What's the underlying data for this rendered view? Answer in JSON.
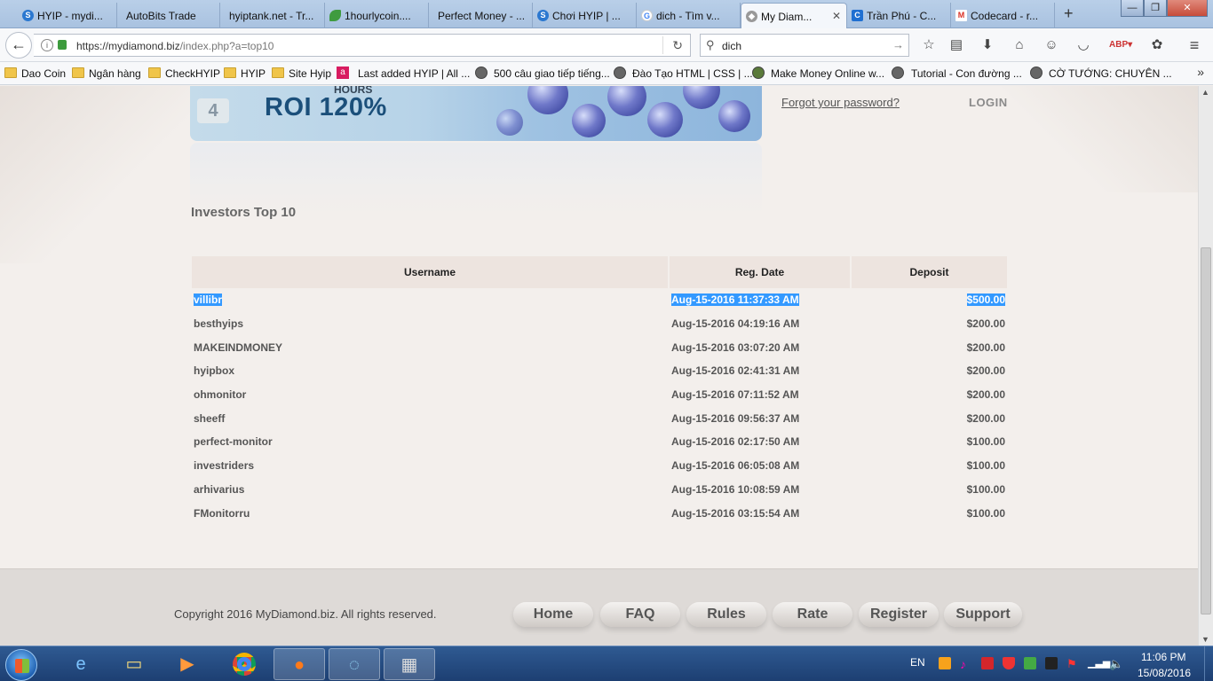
{
  "browser": {
    "tabs": [
      {
        "label": "HYIP - mydi...",
        "icon": "hyip-icon",
        "color": "#2b78d0"
      },
      {
        "label": "AutoBits Trade",
        "icon": "none",
        "color": "#ffffff"
      },
      {
        "label": "hyiptank.net - Tr...",
        "icon": "none",
        "color": "#ffffff"
      },
      {
        "label": "1hourlycoin....",
        "icon": "leaf-icon",
        "color": "#3f9b3f"
      },
      {
        "label": "Perfect Money - ...",
        "icon": "none",
        "color": "#ffffff"
      },
      {
        "label": "Chơi HYIP | ...",
        "icon": "hyip-icon",
        "color": "#2b78d0"
      },
      {
        "label": "dich - Tìm v...",
        "icon": "google-icon",
        "color": "#4285f4"
      },
      {
        "label": "My Diam...",
        "icon": "diamond-icon",
        "color": "#888888"
      },
      {
        "label": "Trần Phú - C...",
        "icon": "c-icon",
        "color": "#1f6fd1"
      },
      {
        "label": "Codecard - r...",
        "icon": "gmail-icon",
        "color": "#d93025"
      }
    ],
    "url_host": "https://mydiamond.biz",
    "url_path": "/index.php?a=top10",
    "search_value": "dich",
    "bookmarks": [
      {
        "label": "Dao Coin",
        "type": "folder"
      },
      {
        "label": "Ngân hàng",
        "type": "folder"
      },
      {
        "label": "CheckHYIP",
        "type": "folder"
      },
      {
        "label": "HYIP",
        "type": "folder"
      },
      {
        "label": "Site Hyip",
        "type": "folder"
      },
      {
        "label": "Last added HYIP | All ...",
        "type": "a-icon"
      },
      {
        "label": "500 câu giao tiếp tiếng...",
        "type": "globe"
      },
      {
        "label": "Đào Tạo HTML | CSS | ...",
        "type": "globe"
      },
      {
        "label": "Make Money Online w...",
        "type": "globe"
      },
      {
        "label": "Tutorial - Con đường ...",
        "type": "globe"
      },
      {
        "label": "CỜ TƯỚNG: CHUYÊN ...",
        "type": "globe"
      }
    ]
  },
  "page": {
    "banner": {
      "step_number": "4",
      "hours_label": "HOURS",
      "roi_label": "ROI 120%"
    },
    "forgot_password": "Forgot your password?",
    "login_label": "LOGIN",
    "section_title": "Investors Top 10",
    "table": {
      "headers": [
        "Username",
        "Reg. Date",
        "Deposit"
      ],
      "rows": [
        {
          "username": "villibr",
          "reg_date": "Aug-15-2016 11:37:33 AM",
          "deposit": "$500.00"
        },
        {
          "username": "besthyips",
          "reg_date": "Aug-15-2016 04:19:16 AM",
          "deposit": "$200.00"
        },
        {
          "username": "MAKEINDMONEY",
          "reg_date": "Aug-15-2016 03:07:20 AM",
          "deposit": "$200.00"
        },
        {
          "username": "hyipbox",
          "reg_date": "Aug-15-2016 02:41:31 AM",
          "deposit": "$200.00"
        },
        {
          "username": "ohmonitor",
          "reg_date": "Aug-15-2016 07:11:52 AM",
          "deposit": "$200.00"
        },
        {
          "username": "sheeff",
          "reg_date": "Aug-15-2016 09:56:37 AM",
          "deposit": "$200.00"
        },
        {
          "username": "perfect-monitor",
          "reg_date": "Aug-15-2016 02:17:50 AM",
          "deposit": "$100.00"
        },
        {
          "username": "investriders",
          "reg_date": "Aug-15-2016 06:05:08 AM",
          "deposit": "$100.00"
        },
        {
          "username": "arhivarius",
          "reg_date": "Aug-15-2016 10:08:59 AM",
          "deposit": "$100.00"
        },
        {
          "username": "FMonitorru",
          "reg_date": "Aug-15-2016 03:15:54 AM",
          "deposit": "$100.00"
        }
      ]
    },
    "footer": {
      "copyright": "Copyright 2016 MyDiamond.biz. All rights reserved.",
      "nav": [
        "Home",
        "FAQ",
        "Rules",
        "Rate",
        "Register",
        "Support"
      ]
    }
  },
  "taskbar": {
    "language": "EN",
    "time": "11:06 PM",
    "date": "15/08/2016"
  },
  "colors": {
    "selection": "#3399ff",
    "page_bg": "#f3efec",
    "table_header_bg": "#ede4df"
  }
}
